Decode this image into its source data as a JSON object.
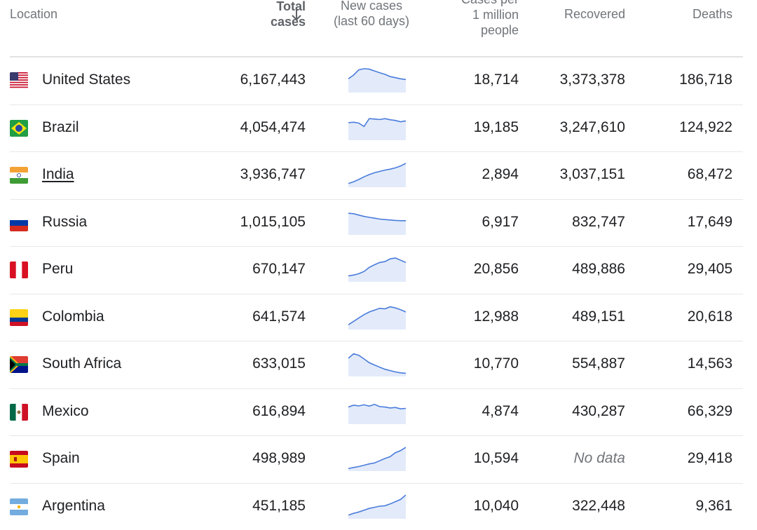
{
  "header": {
    "location": "Location",
    "total_cases": [
      "Total",
      "cases"
    ],
    "new_cases": [
      "New cases",
      "(last 60 days)"
    ],
    "per_million": [
      "Cases per",
      "1 million",
      "people"
    ],
    "recovered": "Recovered",
    "deaths": "Deaths"
  },
  "rows": [
    {
      "name": "United States",
      "flag": "us-flag",
      "total": "6,167,443",
      "per_million": "18,714",
      "recovered": "3,373,378",
      "deaths": "186,718",
      "link": false,
      "trend": [
        0.55,
        0.72,
        0.95,
        1.0,
        0.98,
        0.9,
        0.82,
        0.75,
        0.65,
        0.6,
        0.55,
        0.52
      ]
    },
    {
      "name": "Brazil",
      "flag": "brazil-flag",
      "total": "4,054,474",
      "per_million": "19,185",
      "recovered": "3,247,610",
      "deaths": "124,922",
      "link": false,
      "trend": [
        0.72,
        0.74,
        0.7,
        0.55,
        0.9,
        0.88,
        0.86,
        0.9,
        0.85,
        0.82,
        0.76,
        0.8
      ]
    },
    {
      "name": "India",
      "flag": "india-flag",
      "total": "3,936,747",
      "per_million": "2,894",
      "recovered": "3,037,151",
      "deaths": "68,472",
      "link": true,
      "trend": [
        0.1,
        0.18,
        0.28,
        0.4,
        0.5,
        0.58,
        0.64,
        0.7,
        0.74,
        0.8,
        0.88,
        1.0
      ]
    },
    {
      "name": "Russia",
      "flag": "russia-flag",
      "total": "1,015,105",
      "per_million": "6,917",
      "recovered": "832,747",
      "deaths": "17,649",
      "link": false,
      "trend": [
        0.9,
        0.88,
        0.82,
        0.76,
        0.72,
        0.68,
        0.64,
        0.62,
        0.6,
        0.58,
        0.57,
        0.57
      ]
    },
    {
      "name": "Peru",
      "flag": "peru-flag",
      "total": "670,147",
      "per_million": "20,856",
      "recovered": "489,886",
      "deaths": "29,405",
      "link": false,
      "trend": [
        0.2,
        0.24,
        0.3,
        0.4,
        0.58,
        0.7,
        0.8,
        0.84,
        0.96,
        1.0,
        0.9,
        0.8
      ]
    },
    {
      "name": "Colombia",
      "flag": "colombia-flag",
      "total": "641,574",
      "per_million": "12,988",
      "recovered": "489,151",
      "deaths": "20,618",
      "link": false,
      "trend": [
        0.15,
        0.3,
        0.45,
        0.6,
        0.72,
        0.8,
        0.88,
        0.86,
        0.95,
        0.9,
        0.82,
        0.72
      ]
    },
    {
      "name": "South Africa",
      "flag": "south-africa-flag",
      "total": "633,015",
      "per_million": "10,770",
      "recovered": "554,887",
      "deaths": "14,563",
      "link": false,
      "trend": [
        0.75,
        0.95,
        0.88,
        0.72,
        0.55,
        0.45,
        0.35,
        0.26,
        0.2,
        0.14,
        0.1,
        0.08
      ]
    },
    {
      "name": "Mexico",
      "flag": "mexico-flag",
      "total": "616,894",
      "per_million": "4,874",
      "recovered": "430,287",
      "deaths": "66,329",
      "link": false,
      "trend": [
        0.7,
        0.78,
        0.75,
        0.8,
        0.74,
        0.82,
        0.72,
        0.7,
        0.66,
        0.68,
        0.62,
        0.64
      ]
    },
    {
      "name": "Spain",
      "flag": "spain-flag",
      "total": "498,989",
      "per_million": "10,594",
      "recovered": "No data",
      "deaths": "29,418",
      "link": false,
      "trend": [
        0.05,
        0.1,
        0.14,
        0.2,
        0.26,
        0.3,
        0.4,
        0.5,
        0.58,
        0.76,
        0.85,
        1.0
      ]
    },
    {
      "name": "Argentina",
      "flag": "argentina-flag",
      "total": "451,185",
      "per_million": "10,040",
      "recovered": "322,448",
      "deaths": "9,361",
      "link": false,
      "trend": [
        0.1,
        0.18,
        0.24,
        0.32,
        0.4,
        0.45,
        0.5,
        0.52,
        0.6,
        0.7,
        0.8,
        1.0
      ]
    }
  ],
  "colors": {
    "spark_line": "#4a7cdb",
    "spark_fill": "#e3ebfa",
    "muted": "#70757a"
  }
}
